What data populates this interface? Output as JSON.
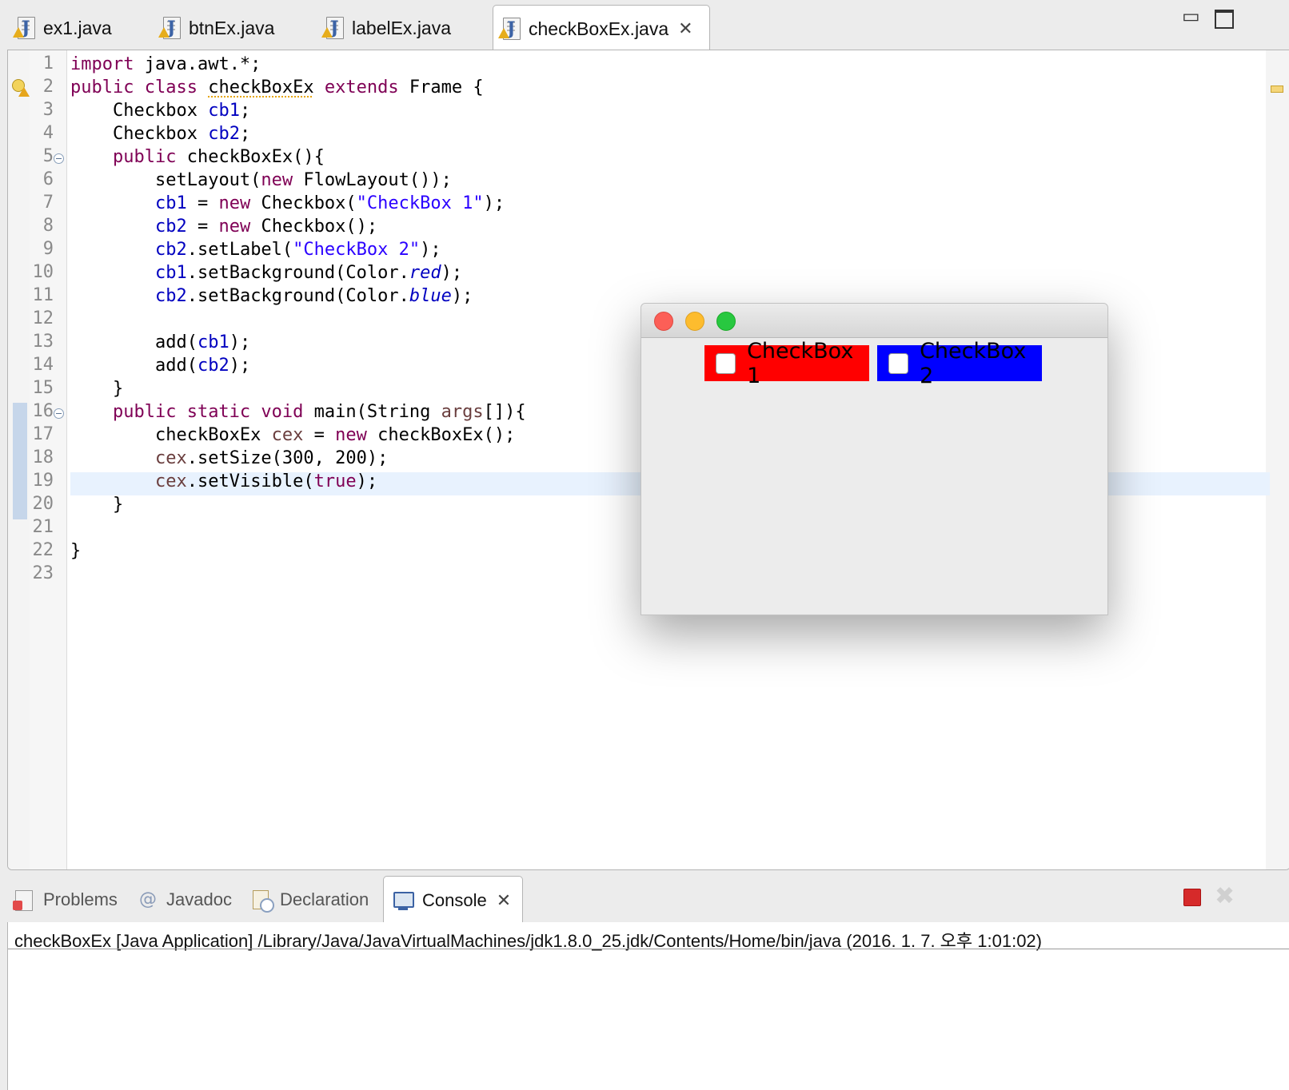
{
  "editor_tabs": [
    {
      "label": "ex1.java"
    },
    {
      "label": "btnEx.java"
    },
    {
      "label": "labelEx.java"
    },
    {
      "label": "checkBoxEx.java",
      "active": true
    }
  ],
  "editor": {
    "line_numbers": [
      "1",
      "2",
      "3",
      "4",
      "5",
      "6",
      "7",
      "8",
      "9",
      "10",
      "11",
      "12",
      "13",
      "14",
      "15",
      "16",
      "17",
      "18",
      "19",
      "20",
      "21",
      "22",
      "23"
    ],
    "code": {
      "l1_kw": "import",
      "l1_rest": " java.awt.*;",
      "l2_kw": "public class",
      "l2_cls": "checkBoxEx",
      "l2_kw2": "extends",
      "l2_rest": " Frame {",
      "l3_type": "Checkbox ",
      "l3_fld": "cb1",
      "l3_end": ";",
      "l4_type": "Checkbox ",
      "l4_fld": "cb2",
      "l4_end": ";",
      "l5_kw": "public",
      "l5_rest": " checkBoxEx(){",
      "l6_a": "setLayout(",
      "l6_kw": "new",
      "l6_b": " FlowLayout());",
      "l7_fld": "cb1",
      "l7_a": " = ",
      "l7_kw": "new",
      "l7_b": " Checkbox(",
      "l7_str": "\"CheckBox 1\"",
      "l7_c": ");",
      "l8_fld": "cb2",
      "l8_a": " = ",
      "l8_kw": "new",
      "l8_b": " Checkbox();",
      "l9_fld": "cb2",
      "l9_a": ".setLabel(",
      "l9_str": "\"CheckBox 2\"",
      "l9_b": ");",
      "l10_fld": "cb1",
      "l10_a": ".setBackground(Color.",
      "l10_sf": "red",
      "l10_b": ");",
      "l11_fld": "cb2",
      "l11_a": ".setBackground(Color.",
      "l11_sf": "blue",
      "l11_b": ");",
      "l13_a": "add(",
      "l13_fld": "cb1",
      "l13_b": ");",
      "l14_a": "add(",
      "l14_fld": "cb2",
      "l14_b": ");",
      "l15": "}",
      "l16_kw": "public static void",
      "l16_a": " main(String ",
      "l16_var": "args",
      "l16_b": "[]){",
      "l17_a": "checkBoxEx ",
      "l17_var": "cex",
      "l17_b": " = ",
      "l17_kw": "new",
      "l17_c": " checkBoxEx();",
      "l18_var": "cex",
      "l18_a": ".setSize(300, 200);",
      "l19_var": "cex",
      "l19_a": ".setVisible(",
      "l19_kw": "true",
      "l19_b": ");",
      "l20": "}",
      "l22": "}"
    }
  },
  "awt_window": {
    "checkbox1": {
      "label": "CheckBox 1",
      "checked": false,
      "bg": "#ff0000"
    },
    "checkbox2": {
      "label": "CheckBox 2",
      "checked": false,
      "bg": "#0000ff"
    }
  },
  "bottom_tabs": [
    {
      "label": "Problems"
    },
    {
      "label": "Javadoc"
    },
    {
      "label": "Declaration"
    },
    {
      "label": "Console",
      "active": true
    }
  ],
  "console": {
    "header": "checkBoxEx [Java Application] /Library/Java/JavaVirtualMachines/jdk1.8.0_25.jdk/Contents/Home/bin/java (2016. 1. 7. 오후 1:01:02)"
  },
  "colors": {
    "keyword": "#7f0055",
    "field": "#0000c0",
    "string": "#2a00ff",
    "local_var": "#6a3e3e",
    "current_line": "#e8f2fe"
  }
}
